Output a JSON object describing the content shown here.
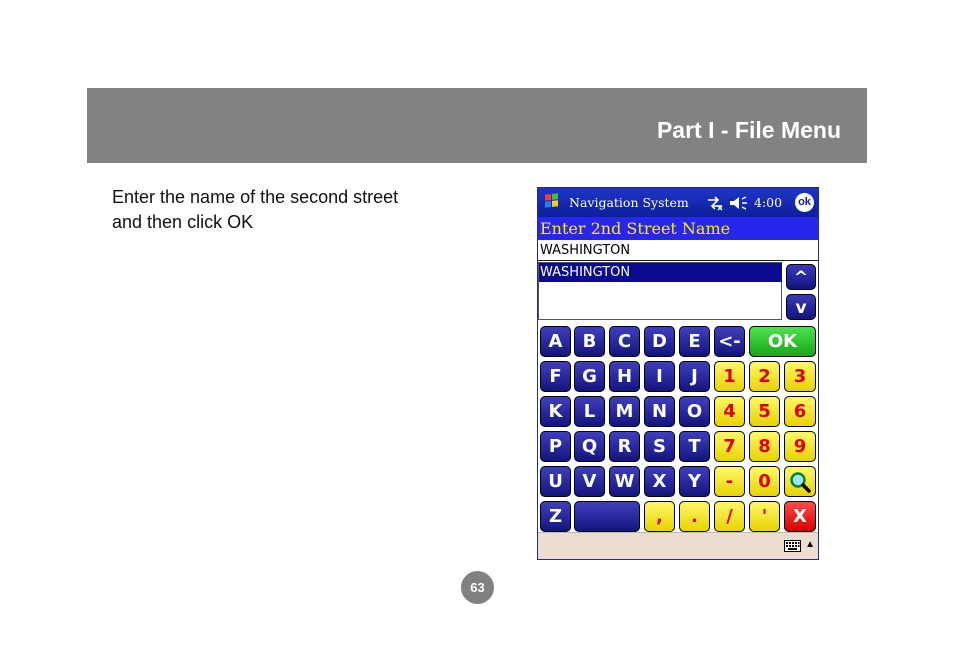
{
  "header": {
    "title": "Part I - File Menu"
  },
  "instruction": {
    "line1": "Enter the name of the second street",
    "line2": "and then click OK"
  },
  "device": {
    "titlebar": {
      "title": "Navigation System",
      "time": "4:00",
      "ok_label": "ok"
    },
    "prompt": "Enter 2nd Street Name",
    "input_value": "WASHINGTON",
    "list_items": [
      "WASHINGTON"
    ],
    "scroll_up_label": "^",
    "scroll_down_label": "v",
    "keys": {
      "letters": [
        "A",
        "B",
        "C",
        "D",
        "E",
        "F",
        "G",
        "H",
        "I",
        "J",
        "K",
        "L",
        "M",
        "N",
        "O",
        "P",
        "Q",
        "R",
        "S",
        "T",
        "U",
        "V",
        "W",
        "X",
        "Y",
        "Z"
      ],
      "backspace": "<-",
      "ok": "OK",
      "digits": [
        "1",
        "2",
        "3",
        "4",
        "5",
        "6",
        "7",
        "8",
        "9",
        "0"
      ],
      "dash": "-",
      "comma": ",",
      "period": ".",
      "slash": "/",
      "apostrophe": "'",
      "cancel": "X"
    },
    "icons": {
      "start": "windows-flag-icon",
      "connection": "connectivity-icon",
      "speaker": "speaker-icon",
      "search": "search-icon",
      "keyboard": "keyboard-icon",
      "caret": "caret-up-icon"
    },
    "colors": {
      "titlebar": "#0d1f9a",
      "prompt_bar": "#2626ec",
      "prompt_text": "#ffec00",
      "blue_key": "#14147e",
      "yellow_key": "#f2e100",
      "ok_key": "#17a717",
      "cancel_key": "#d60000",
      "status_bar": "#efdcd0"
    }
  },
  "page_number": "63"
}
